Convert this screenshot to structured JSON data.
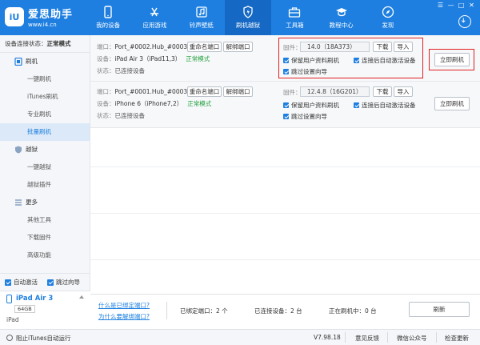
{
  "app": {
    "name": "爱思助手",
    "url": "www.i4.cn",
    "logo_text": "iU"
  },
  "nav": [
    {
      "label": "我的设备",
      "icon": "apple-icon"
    },
    {
      "label": "应用游戏",
      "icon": "app-store-icon"
    },
    {
      "label": "铃声壁纸",
      "icon": "music-icon"
    },
    {
      "label": "刷机越狱",
      "icon": "flash-icon"
    },
    {
      "label": "工具箱",
      "icon": "toolbox-icon"
    },
    {
      "label": "教程中心",
      "icon": "graduation-cap-icon"
    },
    {
      "label": "发现",
      "icon": "compass-icon"
    }
  ],
  "nav_active": "刷机越狱",
  "window_controls": [
    "☰",
    "—",
    "□",
    "✕"
  ],
  "sidebar": {
    "status_label": "设备连接状态：",
    "status_value": "正常模式",
    "flash_section": "刷机",
    "flash_items": [
      "一键刷机",
      "iTunes刷机",
      "专业刷机",
      "批量刷机"
    ],
    "active_item": "批量刷机",
    "jailbreak_section": "越狱",
    "jailbreak_items": [
      "一键越狱",
      "越狱插件"
    ],
    "more_section": "更多",
    "more_items": [
      "其他工具",
      "下载固件",
      "高级功能"
    ],
    "auto_activate": "自动激活",
    "skip_guide": "跳过向导"
  },
  "device_panel": {
    "name": "iPad Air 3",
    "capacity": "64GB",
    "type": "iPad"
  },
  "devices": [
    {
      "port_label": "端口：",
      "port": "Port_#0002.Hub_#0003",
      "device_label": "设备：",
      "device": "iPad Air 3（iPad11,3）",
      "mode": "正常模式",
      "state_label": "状态：",
      "state": "已连接设备",
      "rename_btn": "重命名端口",
      "unbind_btn": "解绑端口",
      "fw_label": "固件：",
      "firmware": "14.0（18A373）",
      "download_btn": "下载",
      "import_btn": "导入",
      "opt_keep_data": "保留用户资料刷机",
      "opt_auto_activate": "连接后自动激活设备",
      "opt_skip_guide": "跳过设置向导",
      "flash_btn": "立即刷机"
    },
    {
      "port_label": "端口：",
      "port": "Port_#0001.Hub_#0003",
      "device_label": "设备：",
      "device": "iPhone 6（iPhone7,2）",
      "mode": "正常模式",
      "state_label": "状态：",
      "state": "已连接设备",
      "rename_btn": "重命名端口",
      "unbind_btn": "解绑端口",
      "fw_label": "固件：",
      "firmware": "12.4.8（16G201）",
      "download_btn": "下载",
      "import_btn": "导入",
      "opt_keep_data": "保留用户资料刷机",
      "opt_auto_activate": "连接后自动激活设备",
      "opt_skip_guide": "跳过设置向导",
      "flash_btn": "立即刷机"
    }
  ],
  "bottom": {
    "link_what_port": "什么是已绑定端口?",
    "link_why_unbind": "为什么要解绑端口?",
    "bound_ports": "已绑定端口：2 个",
    "connected_devices": "已连接设备：2 台",
    "flashing": "正在刷机中：0 台",
    "refresh_btn": "刷新"
  },
  "statusbar": {
    "block_itunes": "阻止iTunes自动运行",
    "version": "V7.98.18",
    "feedback": "意见反馈",
    "wechat": "微信公众号",
    "update": "检查更新"
  },
  "colors": {
    "brand": "#1e7fe0",
    "ok": "#1e9e3a",
    "highlight": "#e02020"
  }
}
